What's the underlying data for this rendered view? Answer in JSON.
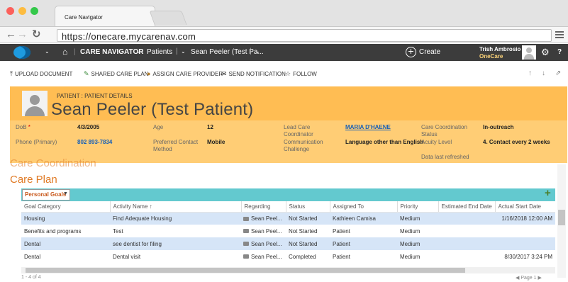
{
  "browser": {
    "tab_title": "Care Navigator",
    "url_prefix": "https://",
    "url_host": "onecare.mycarenav.com"
  },
  "colors": {
    "header_bg": "#ffbd53",
    "summary_bg": "#ffcd75",
    "grid_header_bg": "#63c9cf",
    "accent": "#e07a25",
    "row_highlight": "#d6e5f7"
  },
  "appnav": {
    "app_name": "CARE NAVIGATOR",
    "area": "Patients",
    "record": "Sean Peeler (Test Pa...",
    "create_label": "Create",
    "user_name": "Trish Ambrosio",
    "user_org": "OneCare"
  },
  "commands": {
    "upload": "UPLOAD DOCUMENT",
    "shared": "SHARED CARE PLAN",
    "assign": "ASSIGN CARE PROVIDER",
    "notify": "SEND NOTIFICATION",
    "follow": "FOLLOW"
  },
  "header": {
    "breadcrumb": "PATIENT : PATIENT DETAILS",
    "name": "Sean Peeler (Test Patient)"
  },
  "summary": {
    "dob_label": "DoB",
    "dob_value": "4/3/2005",
    "age_label": "Age",
    "age_value": "12",
    "lead_label_1": "Lead Care",
    "lead_label_2": "Coordinator",
    "lead_value": "MARIA D'HAENE",
    "ccs_label_1": "Care Coordination",
    "ccs_label_2": "Status",
    "ccs_value": "In-outreach",
    "phone_label": "Phone (Primary)",
    "phone_value": "802 893-7834",
    "pcm_label_1": "Preferred Contact",
    "pcm_label_2": "Method",
    "pcm_value": "Mobile",
    "comm_label_1": "Communication",
    "comm_label_2": "Challenge",
    "comm_value": "Language other than English",
    "acuity_label": "Acuity Level",
    "acuity_value": "4. Contact every 2 weeks",
    "refreshed_label": "Data last refreshed"
  },
  "section": {
    "ghost_title": "Care Coordination",
    "title": "Care Plan",
    "picker": "Personal Goals"
  },
  "grid": {
    "columns": [
      "Goal Category",
      "Activity Name ↑",
      "Regarding",
      "Status",
      "Assigned To",
      "Priority",
      "Estimated End Date",
      "Actual Start Date"
    ],
    "rows": [
      {
        "category": "Housing",
        "activity": "Find Adequate Housing",
        "regarding": "Sean Peel...",
        "status": "Not Started",
        "assigned": "Kathleen Camisa",
        "priority": "Medium",
        "end": "",
        "start": "1/16/2018 12:00 AM"
      },
      {
        "category": "Benefits and programs",
        "activity": "Test",
        "regarding": "Sean Peel...",
        "status": "Not Started",
        "assigned": "Patient",
        "priority": "Medium",
        "end": "",
        "start": ""
      },
      {
        "category": "Dental",
        "activity": "see dentist for filing",
        "regarding": "Sean Peel...",
        "status": "Not Started",
        "assigned": "Patient",
        "priority": "Medium",
        "end": "",
        "start": ""
      },
      {
        "category": "Dental",
        "activity": "Dental visit",
        "regarding": "Sean Peel...",
        "status": "Completed",
        "assigned": "Patient",
        "priority": "Medium",
        "end": "",
        "start": "8/30/2017 3:24 PM"
      }
    ]
  },
  "footer": {
    "count": "1 - 4 of 4",
    "page": "Page 1"
  }
}
